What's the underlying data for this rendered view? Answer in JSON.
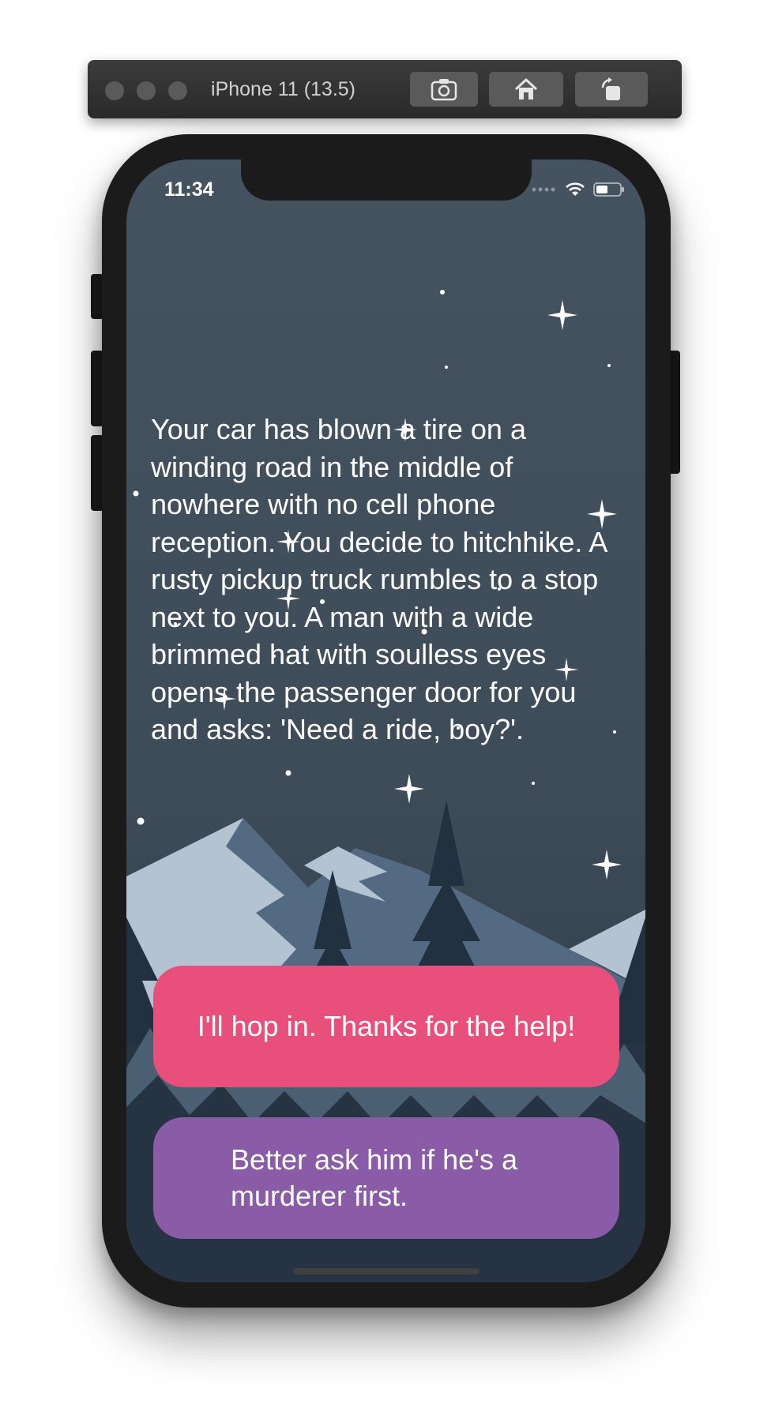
{
  "simulator": {
    "title": "iPhone 11 (13.5)",
    "buttons": [
      "screenshot-icon",
      "home-icon",
      "rotate-icon"
    ]
  },
  "status_bar": {
    "time": "11:34",
    "icons": [
      "cellular-icon",
      "wifi-icon",
      "battery-icon"
    ]
  },
  "story": {
    "text": "Your car has blown a tire on a winding road in the middle of nowhere with no cell phone reception. You decide to hitchhike. A rusty pickup truck rumbles to a stop next to you. A man with a wide brimmed hat with soulless eyes opens the passenger door for you and asks: 'Need a ride, boy?'."
  },
  "choices": [
    {
      "label": "I'll hop in. Thanks for the help!",
      "color": "#e84f7b"
    },
    {
      "label": "Better ask him if he's a murderer first.",
      "color": "#8a5ba6"
    }
  ],
  "colors": {
    "sky": "#45525f",
    "snow": "#b3c3d1",
    "mountain": "#546a82",
    "trees": "#223140"
  }
}
